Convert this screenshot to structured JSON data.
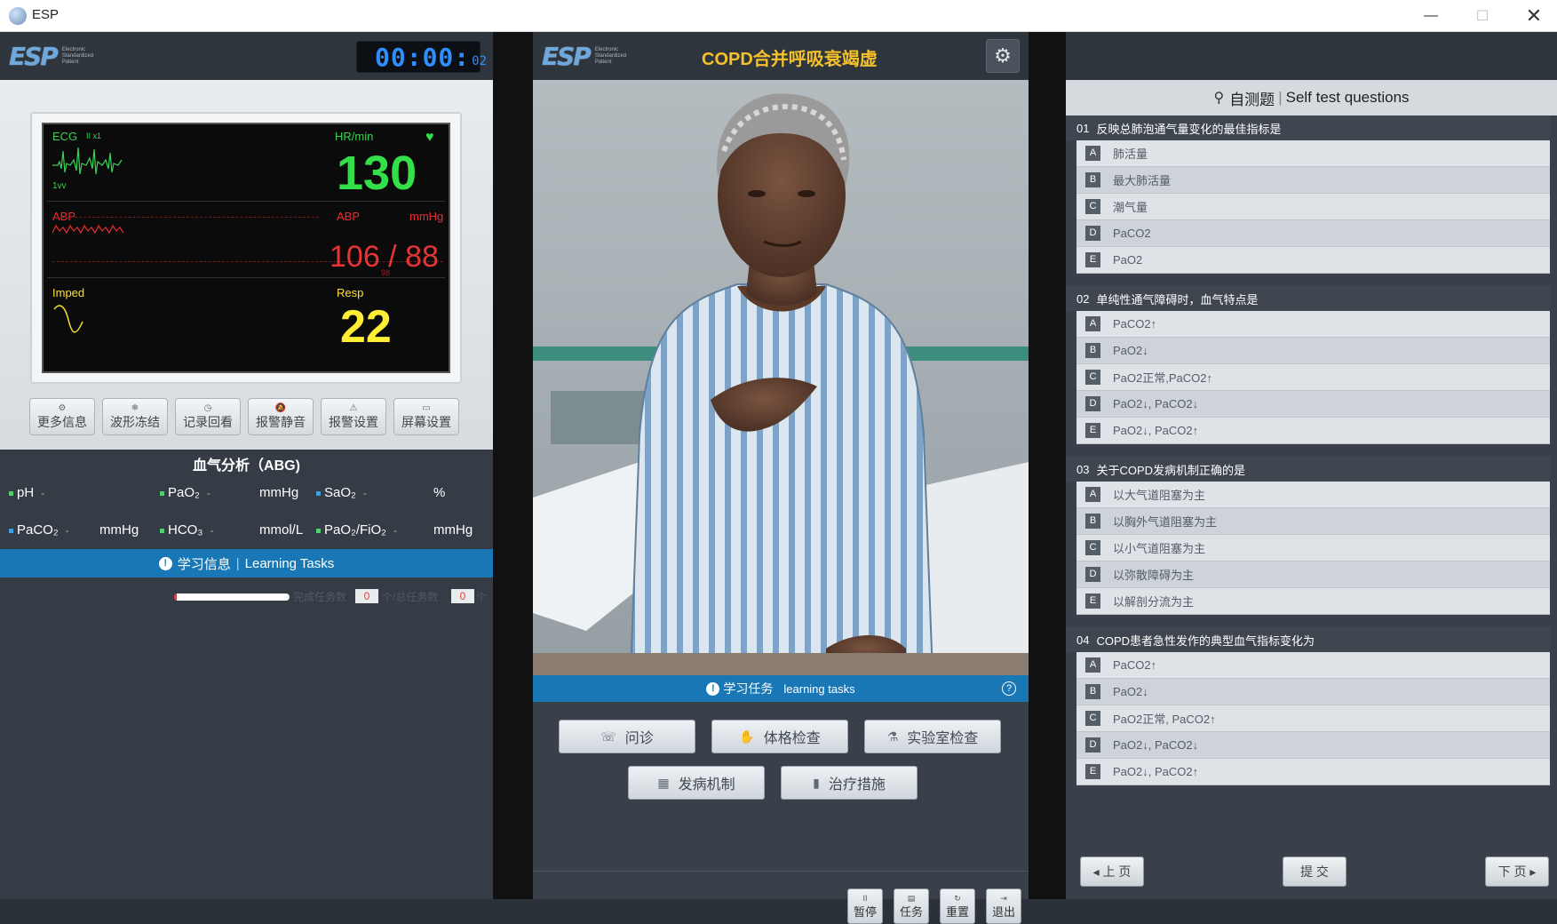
{
  "window": {
    "title": "ESP",
    "min": "—",
    "max": "☐",
    "close": "✕"
  },
  "logo": {
    "mark_a": "ES",
    "mark_b": "P",
    "tag_left": "Electronic Standardized Patient",
    "tag_center": "Electronic Standardized Patient"
  },
  "timer": {
    "main": "00:00:",
    "sub": "02"
  },
  "monitor": {
    "ecg_label": "ECG",
    "ecg_sub": "II  x1",
    "ecg_lead": "1vv",
    "hr_label": "HR/min",
    "hr_value": "130",
    "abp_label": "ABP",
    "abp_label2": "ABP",
    "abp_unit": "mmHg",
    "abp_value": "106 / 88",
    "abp_mean": "98",
    "imp_label": "Imped",
    "resp_label": "Resp",
    "resp_value": "22"
  },
  "monitor_buttons": [
    {
      "label": "更多信息",
      "icon": "⚙"
    },
    {
      "label": "波形冻结",
      "icon": "❄"
    },
    {
      "label": "记录回看",
      "icon": "◷"
    },
    {
      "label": "报警静音",
      "icon": "🔕"
    },
    {
      "label": "报警设置",
      "icon": "⚠"
    },
    {
      "label": "屏幕设置",
      "icon": "▭"
    }
  ],
  "abg": {
    "title": "血气分析（ABG)",
    "row1": [
      {
        "name": "pH",
        "value": "-",
        "unit": ""
      },
      {
        "name": "PaO₂",
        "value": "-",
        "unit": "mmHg"
      },
      {
        "name": "SaO₂",
        "value": "-",
        "unit": "%"
      }
    ],
    "row2": [
      {
        "name": "PaCO₂",
        "value": "-",
        "unit": "mmHg"
      },
      {
        "name": "HCO₃",
        "value": "-",
        "unit": "mmol/L"
      },
      {
        "name": "PaO₂/FiO₂",
        "value": "-",
        "unit": "mmHg"
      }
    ]
  },
  "learning_info": {
    "title": "学习信息",
    "title_en": "Learning Tasks",
    "progress": 0.0,
    "done_label": "完成任务数",
    "done": "0",
    "total_label": "个/总任务数",
    "total": "0",
    "suffix": "个"
  },
  "center": {
    "case_title": "COPD合并呼吸衰竭虚",
    "gear_icon": "⚙",
    "tasks_bar": {
      "title": "学习任务",
      "title_en": "learning tasks",
      "help": "?"
    },
    "task_buttons": [
      {
        "label": "问诊",
        "icon": "☏"
      },
      {
        "label": "体格检查",
        "icon": "✋"
      },
      {
        "label": "实验室检查",
        "icon": "⚗"
      },
      {
        "label": "发病机制",
        "icon": "▦"
      },
      {
        "label": "治疗措施",
        "icon": "▮"
      }
    ],
    "small_buttons": [
      {
        "label": "暂停",
        "icon": "II"
      },
      {
        "label": "任务",
        "icon": "▤"
      },
      {
        "label": "重置",
        "icon": "↻"
      },
      {
        "label": "退出",
        "icon": "⇥"
      }
    ]
  },
  "questions": {
    "title": "自测题",
    "title_en": "Self test questions",
    "items": [
      {
        "num": "01",
        "text": "反映总肺泡通气量变化的最佳指标是",
        "options": [
          {
            "k": "A",
            "t": "肺活量"
          },
          {
            "k": "B",
            "t": "最大肺活量"
          },
          {
            "k": "C",
            "t": "潮气量"
          },
          {
            "k": "D",
            "t": "PaCO2"
          },
          {
            "k": "E",
            "t": "PaO2"
          }
        ]
      },
      {
        "num": "02",
        "text": "单纯性通气障碍时，血气特点是",
        "options": [
          {
            "k": "A",
            "t": "PaCO2↑"
          },
          {
            "k": "B",
            "t": "PaO2↓"
          },
          {
            "k": "C",
            "t": "PaO2正常,PaCO2↑"
          },
          {
            "k": "D",
            "t": " PaO2↓, PaCO2↓"
          },
          {
            "k": "E",
            "t": "PaO2↓, PaCO2↑"
          }
        ]
      },
      {
        "num": "03",
        "text": "关于COPD发病机制正确的是",
        "options": [
          {
            "k": "A",
            "t": "以大气道阻塞为主"
          },
          {
            "k": "B",
            "t": "以胸外气道阻塞为主"
          },
          {
            "k": "C",
            "t": "以小气道阻塞为主"
          },
          {
            "k": "D",
            "t": "以弥散障碍为主"
          },
          {
            "k": "E",
            "t": "以解剖分流为主"
          }
        ]
      },
      {
        "num": "04",
        "text": "COPD患者急性发作的典型血气指标变化为",
        "options": [
          {
            "k": "A",
            "t": " PaCO2↑"
          },
          {
            "k": "B",
            "t": "PaO2↓"
          },
          {
            "k": "C",
            "t": "PaO2正常, PaCO2↑"
          },
          {
            "k": "D",
            "t": "PaO2↓, PaCO2↓"
          },
          {
            "k": "E",
            "t": "PaO2↓, PaCO2↑"
          }
        ]
      }
    ],
    "prev": "◂ 上 页",
    "submit": "提 交",
    "next": "下 页 ▸"
  }
}
